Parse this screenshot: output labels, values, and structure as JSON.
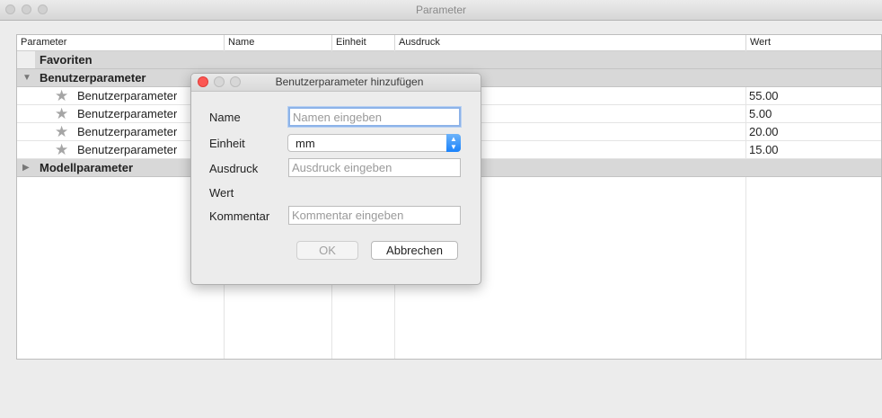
{
  "window": {
    "title": "Parameter"
  },
  "table": {
    "columns": [
      "Parameter",
      "Name",
      "Einheit",
      "Ausdruck",
      "Wert"
    ],
    "groups": {
      "favorites": {
        "label": "Favoriten",
        "expand_icon": ""
      },
      "user": {
        "label": "Benutzerparameter",
        "expand_icon": "▼"
      },
      "model": {
        "label": "Modellparameter",
        "expand_icon": "▶"
      }
    },
    "user_rows": [
      {
        "label": "Benutzerparameter",
        "value": "55.00",
        "icon": "star-icon"
      },
      {
        "label": "Benutzerparameter",
        "value": "5.00",
        "icon": "star-icon"
      },
      {
        "label": "Benutzerparameter",
        "value": "20.00",
        "icon": "star-icon"
      },
      {
        "label": "Benutzerparameter",
        "value": "15.00",
        "icon": "star-icon"
      }
    ]
  },
  "dialog": {
    "title": "Benutzerparameter hinzufügen",
    "labels": {
      "name": "Name",
      "unit": "Einheit",
      "expression": "Ausdruck",
      "value": "Wert",
      "comment": "Kommentar"
    },
    "name_placeholder": "Namen eingeben",
    "unit_value": "mm",
    "expression_placeholder": "Ausdruck eingeben",
    "comment_placeholder": "Kommentar eingeben",
    "ok_label": "OK",
    "cancel_label": "Abbrechen"
  },
  "icons": {
    "star": "★",
    "stepper_up": "▲",
    "stepper_down": "▼"
  },
  "colors": {
    "close_button": "#fc5753",
    "focus_ring": "#8db3e8",
    "stepper_blue": "#1a82fb"
  }
}
